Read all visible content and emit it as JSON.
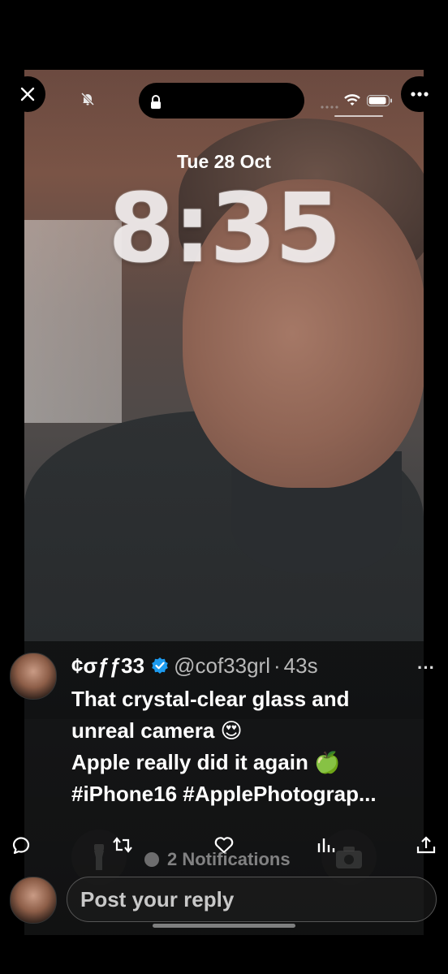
{
  "lockscreen": {
    "date": "Tue 28 Oct",
    "time": "8:35"
  },
  "tweet": {
    "display_name": "¢σƒƒ33",
    "handle": "@cof33grl",
    "separator": "·",
    "time_ago": "43s",
    "more": "···",
    "lines": [
      "That crystal-clear glass and",
      "unreal camera 😍",
      "Apple really did it again 🍏",
      "#iPhone16 #ApplePhotograp..."
    ]
  },
  "lockscreen_bottom": {
    "notifications": "2 Notifications"
  },
  "reply": {
    "placeholder": "Post your reply"
  },
  "icons": {
    "close": "close-icon",
    "more": "more-icon",
    "reply": "comment-icon",
    "retweet": "retweet-icon",
    "like": "heart-icon",
    "views": "analytics-icon",
    "share": "share-icon"
  },
  "colors": {
    "verified": "#1d9bf0",
    "background": "#000000"
  }
}
